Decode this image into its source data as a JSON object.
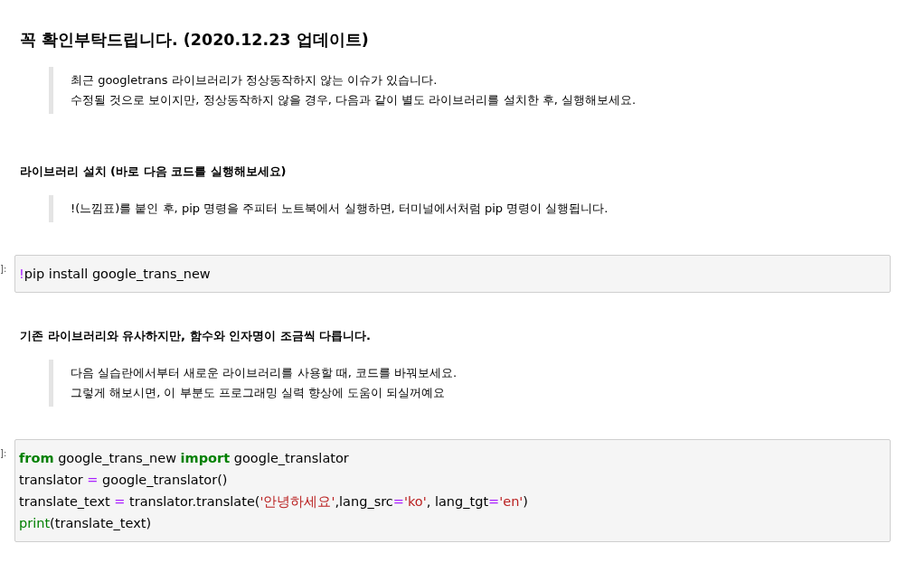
{
  "cells": [
    {
      "kind": "heading",
      "text": "꼭 확인부탁드립니다. (2020.12.23 업데이트)"
    },
    {
      "kind": "quote",
      "lines": [
        "최근 googletrans 라이브러리가 정상동작하지 않는 이슈가 있습니다.",
        "수정될 것으로 보이지만, 정상동작하지 않을 경우, 다음과 같이 별도 라이브러리를 설치한 후, 실행해보세요."
      ]
    },
    {
      "kind": "subheading",
      "text": "라이브러리 설치 (바로 다음 코드를 실행해보세요)"
    },
    {
      "kind": "quote",
      "lines": [
        "!(느낌표)를 붙인 후, pip 명령을 주피터 노트북에서 실행하면, 터미널에서처럼 pip 명령이 실행됩니다."
      ]
    },
    {
      "kind": "code",
      "prompt": "]:",
      "lines": [
        [
          {
            "t": "!",
            "kind": "magic"
          },
          {
            "t": "pip install google_trans_new",
            "kind": "name"
          }
        ]
      ]
    },
    {
      "kind": "subheading",
      "text": "기존 라이브러리와 유사하지만, 함수와 인자명이 조금씩 다릅니다."
    },
    {
      "kind": "quote",
      "lines": [
        "다음 실습란에서부터 새로운 라이브러리를 사용할 때, 코드를 바꿔보세요.",
        "그렇게 해보시면, 이 부분도 프로그래밍 실력 향상에 도움이 되실꺼예요"
      ]
    },
    {
      "kind": "code",
      "prompt": "]:",
      "lines": [
        [
          {
            "t": "from",
            "kind": "keyword"
          },
          {
            "t": " google_trans_new ",
            "kind": "name"
          },
          {
            "t": "import",
            "kind": "keyword"
          },
          {
            "t": " google_translator",
            "kind": "name"
          }
        ],
        [
          {
            "t": "translator ",
            "kind": "name"
          },
          {
            "t": "=",
            "kind": "operator"
          },
          {
            "t": " google_translator()",
            "kind": "name"
          }
        ],
        [
          {
            "t": "translate_text ",
            "kind": "name"
          },
          {
            "t": "=",
            "kind": "operator"
          },
          {
            "t": " translator.translate(",
            "kind": "name"
          },
          {
            "t": "'안녕하세요'",
            "kind": "string"
          },
          {
            "t": ",lang_src",
            "kind": "name"
          },
          {
            "t": "=",
            "kind": "operator"
          },
          {
            "t": "'ko'",
            "kind": "string"
          },
          {
            "t": ", lang_tgt",
            "kind": "name"
          },
          {
            "t": "=",
            "kind": "operator"
          },
          {
            "t": "'en'",
            "kind": "string"
          },
          {
            "t": ")",
            "kind": "name"
          }
        ],
        [
          {
            "t": "print",
            "kind": "builtin"
          },
          {
            "t": "(translate_text)",
            "kind": "name"
          }
        ]
      ]
    }
  ]
}
